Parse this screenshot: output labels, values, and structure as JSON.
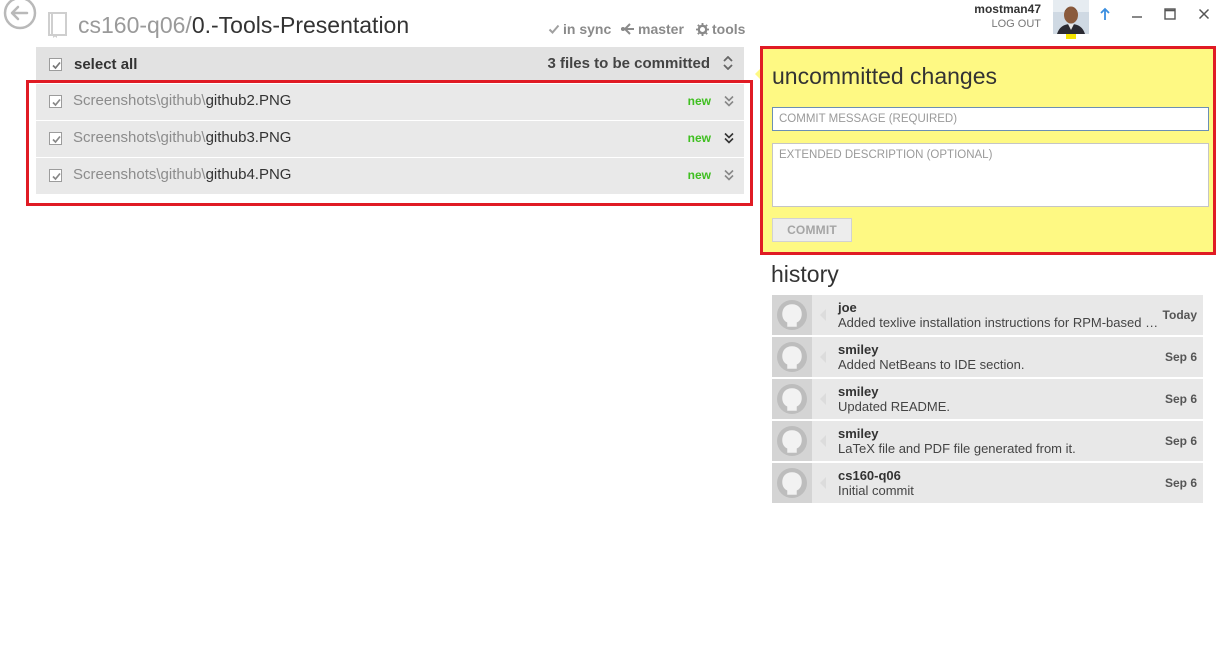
{
  "header": {
    "repo_owner": "cs160-q06/",
    "repo_name": "0.-Tools-Presentation",
    "sync_label": "in sync",
    "branch_label": "master",
    "tools_label": "tools"
  },
  "user": {
    "name": "mostman47",
    "logout_label": "LOG OUT"
  },
  "changes": {
    "select_all_label": "select all",
    "count_label": "3 files to be committed",
    "files": [
      {
        "dir": "Screenshots\\github\\",
        "name": "github2.PNG",
        "status": "new"
      },
      {
        "dir": "Screenshots\\github\\",
        "name": "github3.PNG",
        "status": "new"
      },
      {
        "dir": "Screenshots\\github\\",
        "name": "github4.PNG",
        "status": "new"
      }
    ]
  },
  "commit": {
    "heading": "uncommitted changes",
    "message_placeholder": "COMMIT MESSAGE (REQUIRED)",
    "description_placeholder": "EXTENDED DESCRIPTION (OPTIONAL)",
    "button_label": "COMMIT"
  },
  "history": {
    "heading": "history",
    "items": [
      {
        "author": "joe",
        "message": "Added texlive installation instructions for RPM-based distros",
        "date": "Today"
      },
      {
        "author": "smiley",
        "message": "Added NetBeans to IDE section.",
        "date": "Sep 6"
      },
      {
        "author": "smiley",
        "message": "Updated README.",
        "date": "Sep 6"
      },
      {
        "author": "smiley",
        "message": "LaTeX file and PDF file generated from it.",
        "date": "Sep 6"
      },
      {
        "author": "cs160-q06",
        "message": "Initial commit",
        "date": "Sep 6"
      }
    ]
  },
  "colors": {
    "highlight_border": "#e01b24",
    "commit_panel_bg": "#fef983",
    "status_new": "#3fbf20"
  }
}
